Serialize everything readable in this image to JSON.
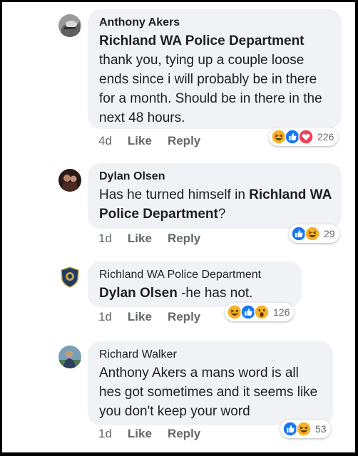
{
  "comments": [
    {
      "author": "Anthony Akers",
      "tag": "Richland WA Police Department",
      "text": "thank you, tying up a couple loose ends since i will probably be in there for a month. Should be in there in the next 48 hours.",
      "time": "4d",
      "like_label": "Like",
      "reply_label": "Reply",
      "reactions": [
        "haha",
        "like",
        "love"
      ],
      "reaction_count": "226"
    },
    {
      "author": "Dylan Olsen",
      "text": "Has he turned himself in ",
      "tag": "Richland WA Police Department",
      "text_after": "?",
      "time": "1d",
      "like_label": "Like",
      "reply_label": "Reply",
      "reactions": [
        "like",
        "haha"
      ],
      "reaction_count": "29"
    },
    {
      "author": "Richland WA Police Department",
      "tag": "Dylan Olsen",
      "text": " -he has not.",
      "time": "1d",
      "like_label": "Like",
      "reply_label": "Reply",
      "reactions": [
        "haha",
        "like",
        "wow"
      ],
      "reaction_count": "126"
    },
    {
      "author": "Richard Walker",
      "text": "Anthony Akers a mans word is all hes got sometimes and it seems like you don't keep your word",
      "time": "1d",
      "like_label": "Like",
      "reply_label": "Reply",
      "reactions": [
        "like",
        "haha"
      ],
      "reaction_count": "53"
    }
  ],
  "colors": {
    "like": "#1877f2",
    "love": "#f33e58",
    "haha": "#f7b125",
    "bubble": "#f0f2f5",
    "meta": "#65676b"
  }
}
